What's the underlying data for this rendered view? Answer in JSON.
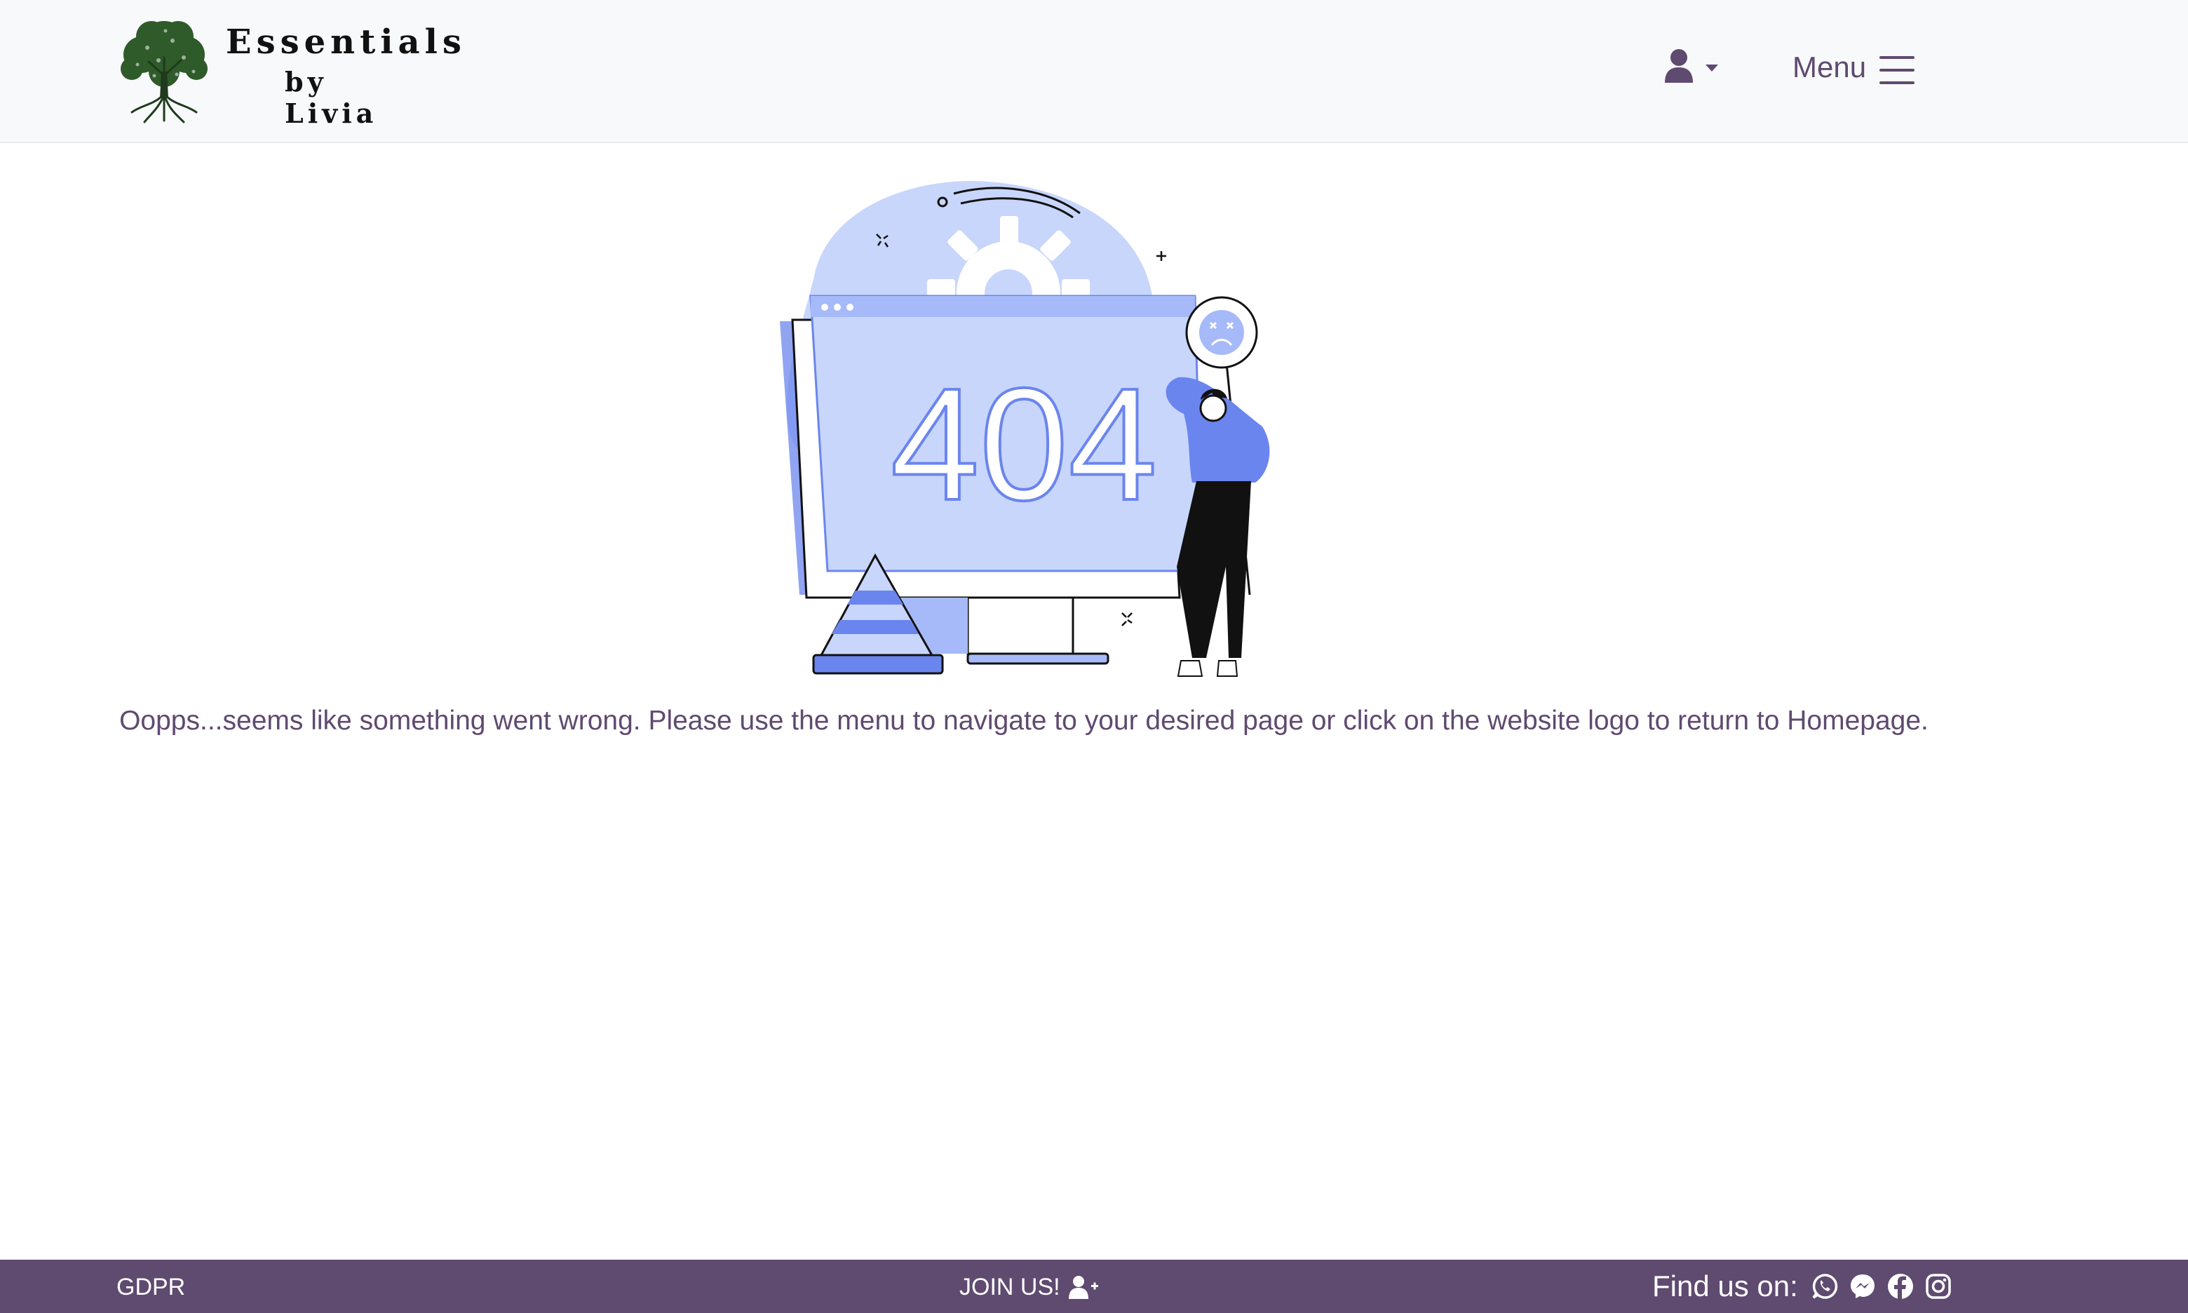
{
  "header": {
    "brand_title": "Essentials",
    "brand_subtitle": "by Livia",
    "menu_label": "Menu",
    "user_icon": "user-icon",
    "menu_icon": "hamburger-icon"
  },
  "main": {
    "illustration_text": "404",
    "message": "Oopps...seems like something went wrong. Please use the menu to navigate to your desired page or click on the website logo to return to Homepage."
  },
  "footer": {
    "gdpr_label": "GDPR",
    "join_label": "JOIN US!",
    "find_label": "Find us on:",
    "social_icons": [
      "whatsapp-icon",
      "messenger-icon",
      "facebook-icon",
      "instagram-icon"
    ]
  },
  "colors": {
    "brand_purple": "#5f4a70",
    "illustration_blue": "#6b85ee",
    "illustration_light": "#c8d6fb",
    "navbar_bg": "#f8f9fa"
  }
}
